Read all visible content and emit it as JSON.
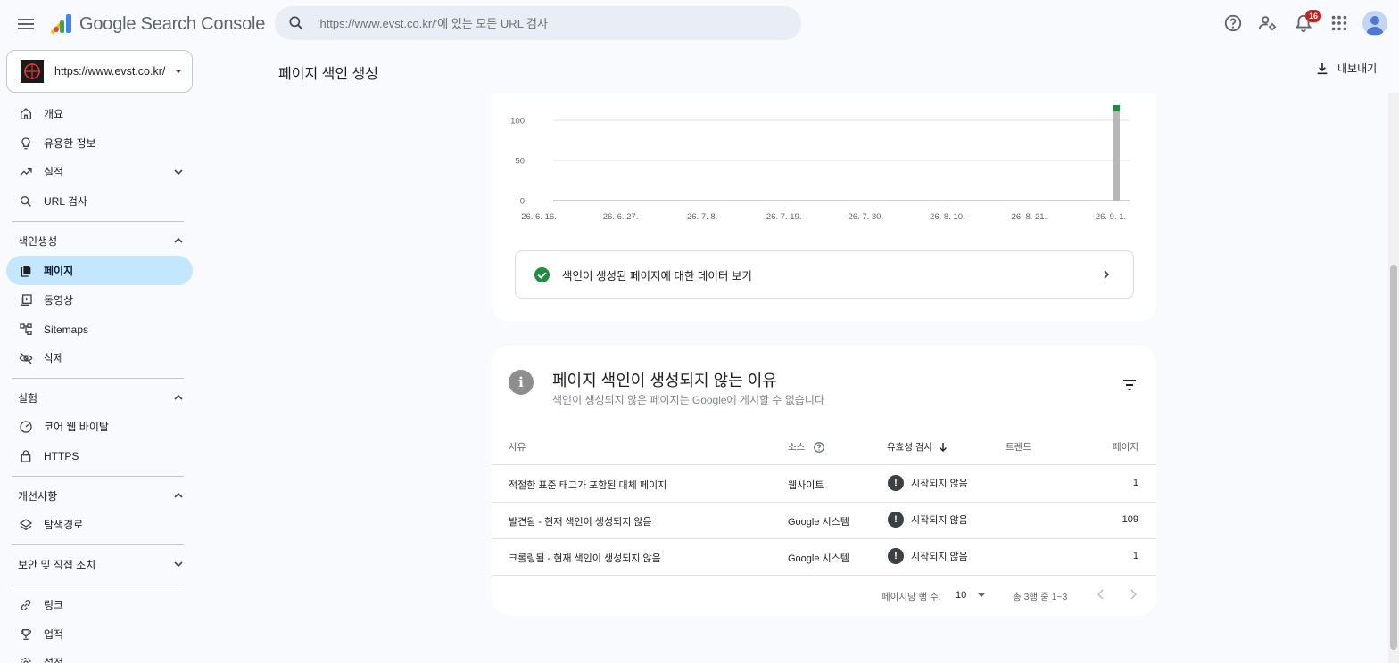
{
  "app": {
    "title": "Google Search Console"
  },
  "search": {
    "placeholder": "'https://www.evst.co.kr/'에 있는 모든 URL 검사"
  },
  "notifications": {
    "count": "16"
  },
  "property": {
    "url": "https://www.evst.co.kr/"
  },
  "sidebar": {
    "items": [
      {
        "label": "개요",
        "icon": "home-icon"
      },
      {
        "label": "유용한 정보",
        "icon": "lightbulb-icon"
      },
      {
        "label": "실적",
        "icon": "trending-up-icon"
      },
      {
        "label": "URL 검사",
        "icon": "search-icon"
      }
    ],
    "sections": {
      "indexing": {
        "label": "색인생성",
        "items": [
          {
            "label": "페이지",
            "icon": "pages-icon",
            "active": true
          },
          {
            "label": "동영상",
            "icon": "video-icon"
          },
          {
            "label": "Sitemaps",
            "icon": "sitemap-icon"
          },
          {
            "label": "삭제",
            "icon": "eye-off-icon"
          }
        ]
      },
      "experience": {
        "label": "실험",
        "items": [
          {
            "label": "코어 웹 바이탈",
            "icon": "speed-icon"
          },
          {
            "label": "HTTPS",
            "icon": "lock-icon"
          }
        ]
      },
      "enhancements": {
        "label": "개선사항",
        "items": [
          {
            "label": "탐색경로",
            "icon": "layers-icon"
          }
        ]
      },
      "security": {
        "label": "보안 및 직접 조치"
      }
    },
    "bottom_items": [
      {
        "label": "링크",
        "icon": "link-icon"
      },
      {
        "label": "업적",
        "icon": "trophy-icon"
      },
      {
        "label": "설정",
        "icon": "settings-icon"
      }
    ]
  },
  "page": {
    "title": "페이지 색인 생성",
    "export_label": "내보내기"
  },
  "chart_data": {
    "type": "bar",
    "categories": [
      "26. 6. 16.",
      "26. 6. 27.",
      "26. 7. 8.",
      "26. 7. 19.",
      "26. 7. 30.",
      "26. 8. 10.",
      "26. 8. 21.",
      "26. 9. 1."
    ],
    "series": [
      {
        "values": [
          0,
          0,
          0,
          0,
          0,
          0,
          0,
          111
        ],
        "color": "#b7b7b7"
      },
      {
        "values": [
          0,
          0,
          0,
          0,
          0,
          0,
          0,
          8
        ],
        "color": "#1e8e3e"
      }
    ],
    "yticks": [
      "0",
      "50",
      "100"
    ],
    "ylim": [
      0,
      119
    ],
    "grid": true
  },
  "indexed_link": {
    "label": "색인이 생성된 페이지에 대한 데이터 보기"
  },
  "reasons": {
    "title": "페이지 색인이 생성되지 않는 이유",
    "subtitle": "색인이 생성되지 않은 페이지는 Google에 게시할 수 없습니다",
    "columns": {
      "reason": "사유",
      "source": "소스",
      "validation": "유효성 검사",
      "trend": "트렌드",
      "pages": "페이지"
    },
    "rows": [
      {
        "reason": "적절한 표준 태그가 포함된 대체 페이지",
        "source": "웹사이트",
        "validation": "시작되지 않음",
        "pages": "1"
      },
      {
        "reason": "발견됨 - 현재 색인이 생성되지 않음",
        "source": "Google 시스템",
        "validation": "시작되지 않음",
        "pages": "109"
      },
      {
        "reason": "크롤링됨 - 현재 색인이 생성되지 않음",
        "source": "Google 시스템",
        "validation": "시작되지 않음",
        "pages": "1"
      }
    ],
    "pagination": {
      "rows_per_page_label": "페이지당 행 수:",
      "rows_per_page": "10",
      "range": "총 3행 중 1~3"
    }
  }
}
